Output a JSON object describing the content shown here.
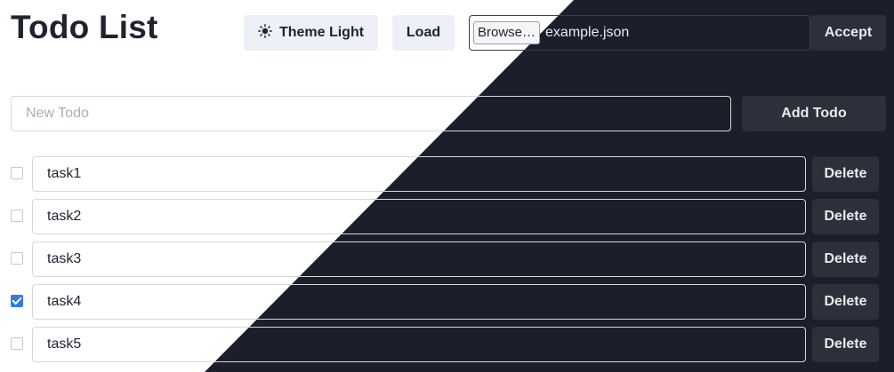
{
  "header": {
    "title": "Todo List",
    "theme_button": {
      "label": "Theme Light",
      "icon": "sun-icon"
    },
    "load_button": "Load",
    "file_input": {
      "browse_label": "Browse…",
      "file_name": "example.json"
    },
    "accept_button": "Accept"
  },
  "new_todo": {
    "placeholder": "New Todo",
    "value": "",
    "add_button": "Add Todo"
  },
  "todos": [
    {
      "text": "task1",
      "done": false,
      "delete_label": "Delete"
    },
    {
      "text": "task2",
      "done": false,
      "delete_label": "Delete"
    },
    {
      "text": "task3",
      "done": false,
      "delete_label": "Delete"
    },
    {
      "text": "task4",
      "done": true,
      "delete_label": "Delete"
    },
    {
      "text": "task5",
      "done": false,
      "delete_label": "Delete"
    }
  ],
  "colors": {
    "light_background": "#ffffff",
    "dark_background": "#1b1f29",
    "checkbox_accent": "#2f7de1"
  }
}
